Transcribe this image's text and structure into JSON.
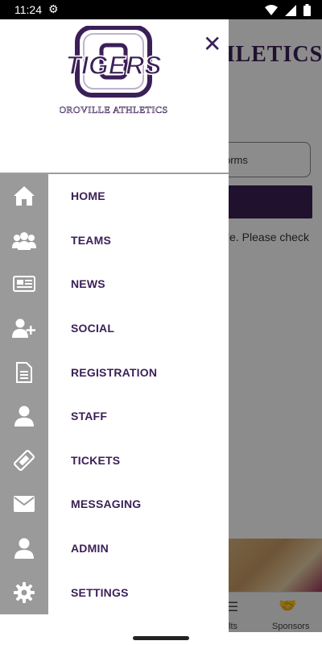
{
  "status_bar": {
    "time": "11:24",
    "icons": [
      "settings-icon",
      "wifi-icon",
      "signal-icon",
      "battery-icon"
    ]
  },
  "background_page": {
    "title": "THLETICS",
    "forms_row_text": "orms",
    "notice_text": "le. Please check",
    "bottom_nav": {
      "results_label": "lts",
      "sponsors_label": "Sponsors"
    }
  },
  "drawer": {
    "logo": {
      "text": "TIGERS",
      "subtitle": "OROVILLE ATHLETICS"
    },
    "menu": [
      {
        "label": "HOME",
        "icon": "home-icon"
      },
      {
        "label": "TEAMS",
        "icon": "users-icon"
      },
      {
        "label": "NEWS",
        "icon": "newspaper-icon"
      },
      {
        "label": "SOCIAL",
        "icon": "user-plus-icon"
      },
      {
        "label": "REGISTRATION",
        "icon": "document-icon"
      },
      {
        "label": "STAFF",
        "icon": "user-icon"
      },
      {
        "label": "TICKETS",
        "icon": "ticket-icon"
      },
      {
        "label": "MESSAGING",
        "icon": "envelope-icon"
      },
      {
        "label": "ADMIN",
        "icon": "user-icon"
      },
      {
        "label": "SETTINGS",
        "icon": "gear-icon"
      }
    ]
  },
  "colors": {
    "brand_purple": "#3b1f57",
    "rail_gray": "#9a9a9a"
  }
}
